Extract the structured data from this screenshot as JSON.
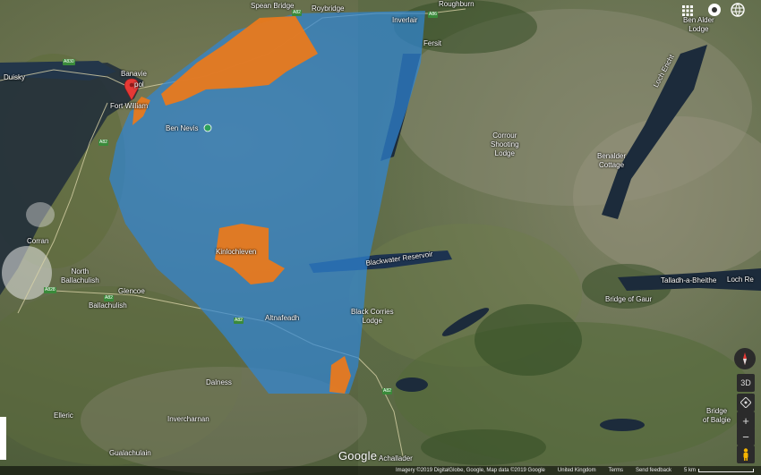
{
  "labels": {
    "spean_bridge": "Spean Bridge",
    "roybridge": "Roybridge",
    "roughburn": "Roughburn",
    "ben_alder_lodge": "Ben Alder\nLodge",
    "inverlair": "Inverlair",
    "fersit": "Fersit",
    "duisky": "Duisky",
    "banavie": "Banavie",
    "corpach": "pol",
    "fort_william": "Fort William",
    "ben_nevis": "Ben Nevis",
    "corrour": "Corrour\nShooting\nLodge",
    "benalder_cottage": "Benalder\nCottage",
    "loch_ericht": "Loch Ericht",
    "kinlochleven": "Kinlochleven",
    "blackwater": "Blackwater Reservoir",
    "corran": "Corran",
    "north_ballachulish": "North\nBallachulish",
    "glencoe": "Glencoe",
    "ballachulish": "Ballachulish",
    "altnafeadh": "Altnafeadh",
    "black_corries": "Black Corries\nLodge",
    "talladh": "Talladh-a-Bheithe",
    "loch_rannoch": "Loch Re",
    "bridge_of_gaur": "Bridge of Gaur",
    "dalness": "Dalness",
    "elleric": "Elleric",
    "invercharnan": "Invercharnan",
    "gualachulain": "Gualachulain",
    "achallader": "Achallader",
    "bridge_of_balgie": "Bridge\nof Balgie"
  },
  "roads": {
    "a830": "A830",
    "a86": "A86",
    "a82_n": "A82",
    "a82_w": "A82",
    "a828": "A828",
    "a82_glencoe": "A82",
    "a82_rannoch": "A82",
    "a82_s": "A82"
  },
  "controls": {
    "three_d": "3D",
    "zoom_in": "+",
    "zoom_out": "−"
  },
  "footer": {
    "imagery": "Imagery ©2019 DigitalGlobe, Google, Map data ©2019 Google",
    "region": "United Kingdom",
    "terms": "Terms",
    "feedback": "Send feedback",
    "scale": "5 km"
  },
  "branding": {
    "logo": "Google"
  },
  "colors": {
    "polygon_blue": "#2f86d6",
    "polygon_orange": "#e8791e",
    "marker_red": "#e53935"
  }
}
